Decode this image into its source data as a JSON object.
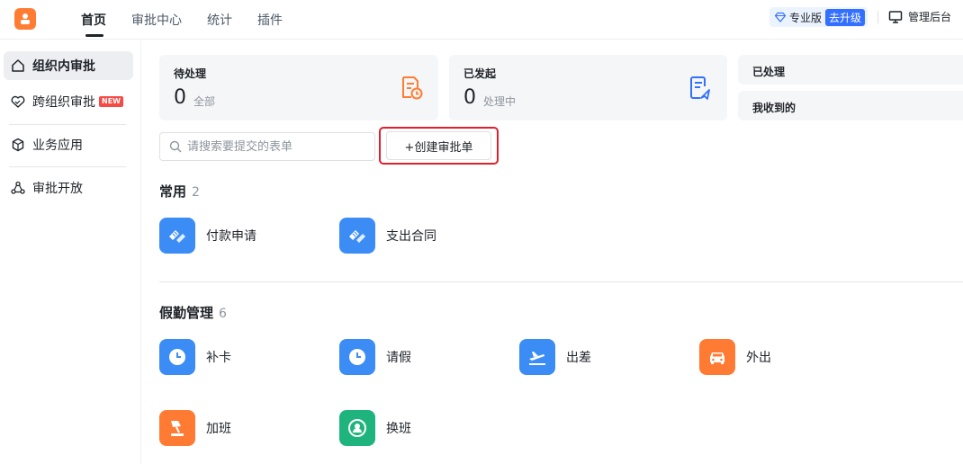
{
  "topbar": {
    "tabs": [
      {
        "label": "首页",
        "active": true
      },
      {
        "label": "审批中心"
      },
      {
        "label": "统计"
      },
      {
        "label": "插件"
      }
    ],
    "pro_label": "专业版",
    "upgrade_label": "去升级",
    "admin_label": "管理后台"
  },
  "sidebar": {
    "items": [
      {
        "label": "组织内审批",
        "icon": "home-icon",
        "active": true
      },
      {
        "label": "跨组织审批",
        "icon": "handshake-icon",
        "badge": "NEW"
      },
      {
        "label": "业务应用",
        "icon": "cube-icon"
      },
      {
        "label": "审批开放",
        "icon": "share-nodes-icon"
      }
    ]
  },
  "stats": {
    "pending": {
      "title": "待处理",
      "count": "0",
      "sub": "全部",
      "icon": "document-clock-icon"
    },
    "initiated": {
      "title": "已发起",
      "count": "0",
      "sub": "处理中",
      "icon": "document-send-icon"
    },
    "processed": {
      "title": "已处理"
    },
    "received": {
      "title": "我收到的"
    }
  },
  "search": {
    "placeholder": "请搜索要提交的表单"
  },
  "create_button": {
    "label": "+创建审批单"
  },
  "sections": [
    {
      "title": "常用",
      "count": "2",
      "apps": [
        {
          "label": "付款申请",
          "icon": "payment-icon",
          "color": "#3c8cf5"
        },
        {
          "label": "支出合同",
          "icon": "contract-icon",
          "color": "#3c8cf5"
        }
      ]
    },
    {
      "title": "假勤管理",
      "count": "6",
      "apps": [
        {
          "label": "补卡",
          "icon": "clock-icon",
          "color": "#3c8cf5"
        },
        {
          "label": "请假",
          "icon": "clock-icon",
          "color": "#3c8cf5"
        },
        {
          "label": "出差",
          "icon": "airplane-icon",
          "color": "#3c8cf5"
        },
        {
          "label": "外出",
          "icon": "car-icon",
          "color": "#ff7a33"
        },
        {
          "label": "加班",
          "icon": "desk-lamp-icon",
          "color": "#ff7a33"
        },
        {
          "label": "换班",
          "icon": "swap-user-icon",
          "color": "#1fb47d"
        }
      ]
    }
  ],
  "colors": {
    "accent": "#3370ff",
    "orange": "#ff7d33",
    "highlight": "#e0202e"
  }
}
